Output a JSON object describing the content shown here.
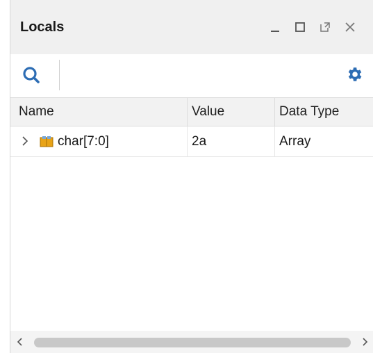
{
  "panel": {
    "title": "Locals"
  },
  "window_controls": {
    "minimize_icon": "minimize-icon",
    "maximize_icon": "maximize-icon",
    "float_icon": "float-icon",
    "close_icon": "close-icon"
  },
  "toolbar": {
    "search_icon": "search-icon",
    "settings_icon": "gear-icon"
  },
  "table": {
    "columns": [
      "Name",
      "Value",
      "Data Type"
    ],
    "rows": [
      {
        "name": "char[7:0]",
        "value": "2a",
        "data_type": "Array",
        "icon": "array-variable-icon",
        "expander": "chevron-right-icon"
      }
    ]
  },
  "colors": {
    "title_bar_bg": "#f0f0f0",
    "accent_blue": "#2d6db4",
    "header_bg": "#f2f2f2",
    "icon_orange": "#e8a317"
  }
}
